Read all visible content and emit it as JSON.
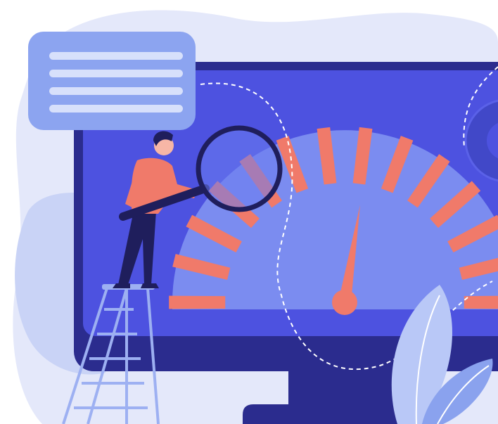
{
  "illustration": {
    "subject": "speed-gauge-monitor",
    "icons": [
      "speech-bubble-icon",
      "gear-icon",
      "magnifying-glass-icon",
      "ladder-icon",
      "plant-leaf-icon",
      "gauge-icon"
    ],
    "colors": {
      "background_blob": "#E4E8FA",
      "monitor_frame": "#2B2C8E",
      "screen": "#4D52E0",
      "gauge_face": "#7B8CF0",
      "gauge_ticks": "#F07A6A",
      "needle": "#F07A6A",
      "bubble": "#8CA4F0",
      "bubble_lines": "#D7E0FB",
      "figure_shirt": "#F07A6A",
      "figure_pants": "#1F1E5C",
      "ladder": "#9DB0F2",
      "leaf_light": "#B9C8F7",
      "leaf_mid": "#8AA2EE"
    },
    "gauge_level": 0.55
  }
}
